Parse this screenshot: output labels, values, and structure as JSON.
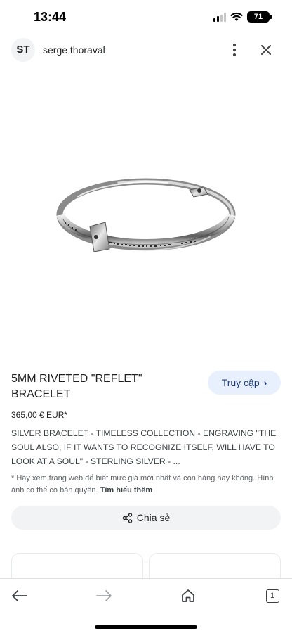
{
  "status_bar": {
    "time": "13:44",
    "battery": "71",
    "icons": [
      "signal-icon",
      "wifi-icon",
      "battery-icon"
    ]
  },
  "header": {
    "avatar_initials": "ST",
    "site_name": "serge thoraval",
    "icons": [
      "more-vertical-icon",
      "close-icon"
    ]
  },
  "product": {
    "image_subject": "silver bracelet",
    "title": "5MM RIVETED \"REFLET\" BRACELET",
    "visit_label": "Truy cập",
    "price": "365,00 € EUR*",
    "description": "SILVER BRACELET - TIMELESS COLLECTION - ENGRAVING \"THE SOUL ALSO, IF IT WANTS TO RECOGNIZE ITSELF, WILL HAVE TO LOOK AT A SOUL\" - STERLING SILVER - ...",
    "disclaimer": "* Hãy xem trang web để biết mức giá mới nhất và còn hàng hay không. Hình ảnh có thể có bản quyền.",
    "learn_more": "Tìm hiểu thêm",
    "share_label": "Chia sẻ"
  },
  "bottom_nav": {
    "icons": [
      "back-arrow-icon",
      "forward-arrow-icon",
      "home-icon",
      "tabs-icon"
    ],
    "tab_count": "1"
  },
  "colors": {
    "visit_button_bg": "#e8f0fe",
    "visit_button_text": "#1a3a7a",
    "share_button_bg": "#f1f3f4"
  }
}
